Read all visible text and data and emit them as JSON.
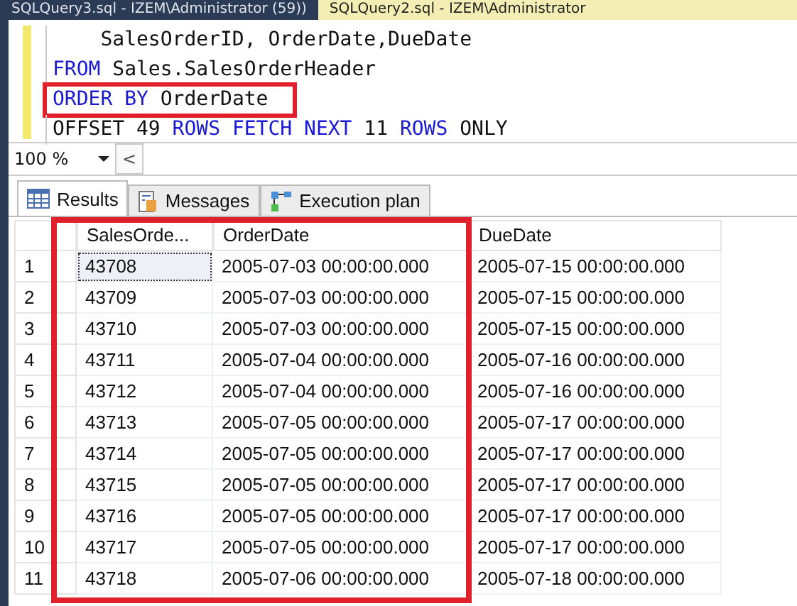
{
  "document_tabs": [
    {
      "label": "SQLQuery3.sql - IZEM\\Administrator (59))",
      "selected": false
    },
    {
      "label": "SQLQuery2.sql - IZEM\\Administrator",
      "selected": true
    }
  ],
  "editor": {
    "lines": [
      [
        {
          "text": "    SalesOrderID, OrderDate,DueDate",
          "kind": "plain"
        }
      ],
      [
        {
          "text": "FROM",
          "kind": "keyword"
        },
        {
          "text": " Sales.SalesOrderHeader",
          "kind": "plain"
        }
      ],
      [
        {
          "text": "ORDER BY",
          "kind": "keyword"
        },
        {
          "text": " OrderDate",
          "kind": "plain"
        }
      ],
      [
        {
          "text": "OFFSET 49 ",
          "kind": "plain"
        },
        {
          "text": "ROWS FETCH NEXT",
          "kind": "keyword"
        },
        {
          "text": " 11 ",
          "kind": "plain"
        },
        {
          "text": "ROWS",
          "kind": "keyword"
        },
        {
          "text": " ONLY",
          "kind": "plain"
        }
      ]
    ],
    "highlighted_lines": [
      false,
      false,
      true,
      false
    ]
  },
  "zoom": {
    "value": "100 %",
    "scroll_arrow": "<"
  },
  "result_tabs": [
    {
      "label": "Results",
      "selected": true
    },
    {
      "label": "Messages",
      "selected": false
    },
    {
      "label": "Execution plan",
      "selected": false
    }
  ],
  "table": {
    "columns": [
      {
        "label": "SalesOrde...",
        "highlighted": true
      },
      {
        "label": "OrderDate",
        "highlighted": true
      },
      {
        "label": "DueDate",
        "highlighted": false
      }
    ],
    "rows": [
      {
        "number": "1",
        "cells": [
          "43708",
          "2005-07-03 00:00:00.000",
          "2005-07-15 00:00:00.000"
        ]
      },
      {
        "number": "2",
        "cells": [
          "43709",
          "2005-07-03 00:00:00.000",
          "2005-07-15 00:00:00.000"
        ]
      },
      {
        "number": "3",
        "cells": [
          "43710",
          "2005-07-03 00:00:00.000",
          "2005-07-15 00:00:00.000"
        ]
      },
      {
        "number": "4",
        "cells": [
          "43711",
          "2005-07-04 00:00:00.000",
          "2005-07-16 00:00:00.000"
        ]
      },
      {
        "number": "5",
        "cells": [
          "43712",
          "2005-07-04 00:00:00.000",
          "2005-07-16 00:00:00.000"
        ]
      },
      {
        "number": "6",
        "cells": [
          "43713",
          "2005-07-05 00:00:00.000",
          "2005-07-17 00:00:00.000"
        ]
      },
      {
        "number": "7",
        "cells": [
          "43714",
          "2005-07-05 00:00:00.000",
          "2005-07-17 00:00:00.000"
        ]
      },
      {
        "number": "8",
        "cells": [
          "43715",
          "2005-07-05 00:00:00.000",
          "2005-07-17 00:00:00.000"
        ]
      },
      {
        "number": "9",
        "cells": [
          "43716",
          "2005-07-05 00:00:00.000",
          "2005-07-17 00:00:00.000"
        ]
      },
      {
        "number": "10",
        "cells": [
          "43717",
          "2005-07-05 00:00:00.000",
          "2005-07-17 00:00:00.000"
        ]
      },
      {
        "number": "11",
        "cells": [
          "43718",
          "2005-07-06 00:00:00.000",
          "2005-07-18 00:00:00.000"
        ]
      }
    ]
  }
}
